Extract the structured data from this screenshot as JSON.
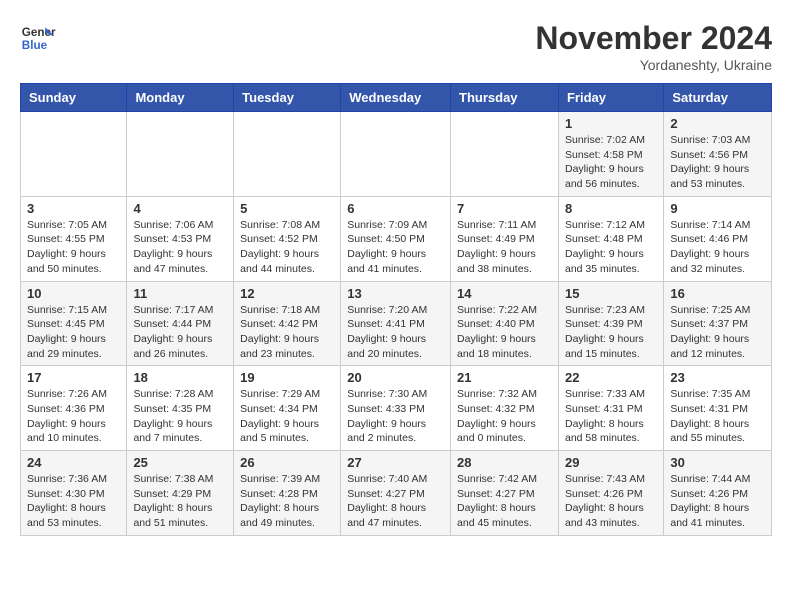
{
  "logo": {
    "line1": "General",
    "line2": "Blue"
  },
  "title": "November 2024",
  "location": "Yordaneshty, Ukraine",
  "days_of_week": [
    "Sunday",
    "Monday",
    "Tuesday",
    "Wednesday",
    "Thursday",
    "Friday",
    "Saturday"
  ],
  "weeks": [
    [
      {
        "day": "",
        "sunrise": "",
        "sunset": "",
        "daylight": ""
      },
      {
        "day": "",
        "sunrise": "",
        "sunset": "",
        "daylight": ""
      },
      {
        "day": "",
        "sunrise": "",
        "sunset": "",
        "daylight": ""
      },
      {
        "day": "",
        "sunrise": "",
        "sunset": "",
        "daylight": ""
      },
      {
        "day": "",
        "sunrise": "",
        "sunset": "",
        "daylight": ""
      },
      {
        "day": "1",
        "sunrise": "Sunrise: 7:02 AM",
        "sunset": "Sunset: 4:58 PM",
        "daylight": "Daylight: 9 hours and 56 minutes."
      },
      {
        "day": "2",
        "sunrise": "Sunrise: 7:03 AM",
        "sunset": "Sunset: 4:56 PM",
        "daylight": "Daylight: 9 hours and 53 minutes."
      }
    ],
    [
      {
        "day": "3",
        "sunrise": "Sunrise: 7:05 AM",
        "sunset": "Sunset: 4:55 PM",
        "daylight": "Daylight: 9 hours and 50 minutes."
      },
      {
        "day": "4",
        "sunrise": "Sunrise: 7:06 AM",
        "sunset": "Sunset: 4:53 PM",
        "daylight": "Daylight: 9 hours and 47 minutes."
      },
      {
        "day": "5",
        "sunrise": "Sunrise: 7:08 AM",
        "sunset": "Sunset: 4:52 PM",
        "daylight": "Daylight: 9 hours and 44 minutes."
      },
      {
        "day": "6",
        "sunrise": "Sunrise: 7:09 AM",
        "sunset": "Sunset: 4:50 PM",
        "daylight": "Daylight: 9 hours and 41 minutes."
      },
      {
        "day": "7",
        "sunrise": "Sunrise: 7:11 AM",
        "sunset": "Sunset: 4:49 PM",
        "daylight": "Daylight: 9 hours and 38 minutes."
      },
      {
        "day": "8",
        "sunrise": "Sunrise: 7:12 AM",
        "sunset": "Sunset: 4:48 PM",
        "daylight": "Daylight: 9 hours and 35 minutes."
      },
      {
        "day": "9",
        "sunrise": "Sunrise: 7:14 AM",
        "sunset": "Sunset: 4:46 PM",
        "daylight": "Daylight: 9 hours and 32 minutes."
      }
    ],
    [
      {
        "day": "10",
        "sunrise": "Sunrise: 7:15 AM",
        "sunset": "Sunset: 4:45 PM",
        "daylight": "Daylight: 9 hours and 29 minutes."
      },
      {
        "day": "11",
        "sunrise": "Sunrise: 7:17 AM",
        "sunset": "Sunset: 4:44 PM",
        "daylight": "Daylight: 9 hours and 26 minutes."
      },
      {
        "day": "12",
        "sunrise": "Sunrise: 7:18 AM",
        "sunset": "Sunset: 4:42 PM",
        "daylight": "Daylight: 9 hours and 23 minutes."
      },
      {
        "day": "13",
        "sunrise": "Sunrise: 7:20 AM",
        "sunset": "Sunset: 4:41 PM",
        "daylight": "Daylight: 9 hours and 20 minutes."
      },
      {
        "day": "14",
        "sunrise": "Sunrise: 7:22 AM",
        "sunset": "Sunset: 4:40 PM",
        "daylight": "Daylight: 9 hours and 18 minutes."
      },
      {
        "day": "15",
        "sunrise": "Sunrise: 7:23 AM",
        "sunset": "Sunset: 4:39 PM",
        "daylight": "Daylight: 9 hours and 15 minutes."
      },
      {
        "day": "16",
        "sunrise": "Sunrise: 7:25 AM",
        "sunset": "Sunset: 4:37 PM",
        "daylight": "Daylight: 9 hours and 12 minutes."
      }
    ],
    [
      {
        "day": "17",
        "sunrise": "Sunrise: 7:26 AM",
        "sunset": "Sunset: 4:36 PM",
        "daylight": "Daylight: 9 hours and 10 minutes."
      },
      {
        "day": "18",
        "sunrise": "Sunrise: 7:28 AM",
        "sunset": "Sunset: 4:35 PM",
        "daylight": "Daylight: 9 hours and 7 minutes."
      },
      {
        "day": "19",
        "sunrise": "Sunrise: 7:29 AM",
        "sunset": "Sunset: 4:34 PM",
        "daylight": "Daylight: 9 hours and 5 minutes."
      },
      {
        "day": "20",
        "sunrise": "Sunrise: 7:30 AM",
        "sunset": "Sunset: 4:33 PM",
        "daylight": "Daylight: 9 hours and 2 minutes."
      },
      {
        "day": "21",
        "sunrise": "Sunrise: 7:32 AM",
        "sunset": "Sunset: 4:32 PM",
        "daylight": "Daylight: 9 hours and 0 minutes."
      },
      {
        "day": "22",
        "sunrise": "Sunrise: 7:33 AM",
        "sunset": "Sunset: 4:31 PM",
        "daylight": "Daylight: 8 hours and 58 minutes."
      },
      {
        "day": "23",
        "sunrise": "Sunrise: 7:35 AM",
        "sunset": "Sunset: 4:31 PM",
        "daylight": "Daylight: 8 hours and 55 minutes."
      }
    ],
    [
      {
        "day": "24",
        "sunrise": "Sunrise: 7:36 AM",
        "sunset": "Sunset: 4:30 PM",
        "daylight": "Daylight: 8 hours and 53 minutes."
      },
      {
        "day": "25",
        "sunrise": "Sunrise: 7:38 AM",
        "sunset": "Sunset: 4:29 PM",
        "daylight": "Daylight: 8 hours and 51 minutes."
      },
      {
        "day": "26",
        "sunrise": "Sunrise: 7:39 AM",
        "sunset": "Sunset: 4:28 PM",
        "daylight": "Daylight: 8 hours and 49 minutes."
      },
      {
        "day": "27",
        "sunrise": "Sunrise: 7:40 AM",
        "sunset": "Sunset: 4:27 PM",
        "daylight": "Daylight: 8 hours and 47 minutes."
      },
      {
        "day": "28",
        "sunrise": "Sunrise: 7:42 AM",
        "sunset": "Sunset: 4:27 PM",
        "daylight": "Daylight: 8 hours and 45 minutes."
      },
      {
        "day": "29",
        "sunrise": "Sunrise: 7:43 AM",
        "sunset": "Sunset: 4:26 PM",
        "daylight": "Daylight: 8 hours and 43 minutes."
      },
      {
        "day": "30",
        "sunrise": "Sunrise: 7:44 AM",
        "sunset": "Sunset: 4:26 PM",
        "daylight": "Daylight: 8 hours and 41 minutes."
      }
    ]
  ]
}
